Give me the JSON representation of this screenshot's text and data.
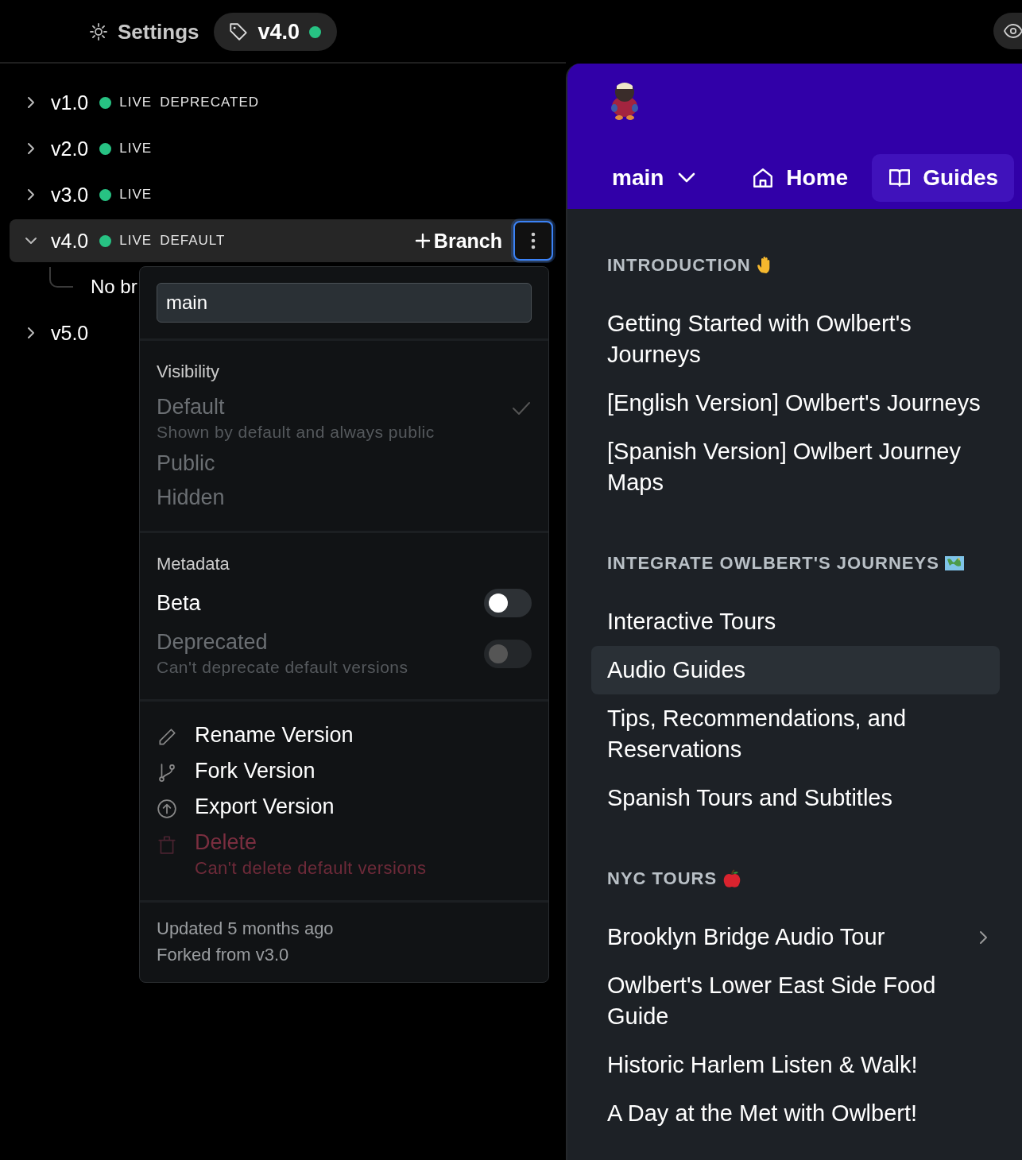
{
  "header": {
    "settings_label": "Settings",
    "version_badge": {
      "label": "v4.0",
      "live": true
    }
  },
  "versions": [
    {
      "label": "v1.0",
      "live": true,
      "expanded": false,
      "selected": false,
      "tags": [
        "LIVE",
        "DEPRECATED"
      ]
    },
    {
      "label": "v2.0",
      "live": true,
      "expanded": false,
      "selected": false,
      "tags": [
        "LIVE"
      ]
    },
    {
      "label": "v3.0",
      "live": true,
      "expanded": false,
      "selected": false,
      "tags": [
        "LIVE"
      ]
    },
    {
      "label": "v4.0",
      "live": true,
      "expanded": true,
      "selected": true,
      "tags": [
        "LIVE",
        "DEFAULT"
      ],
      "branch_button": "Branch",
      "children": [
        {
          "label": "No br"
        }
      ]
    },
    {
      "label": "v5.0",
      "live": false,
      "expanded": false,
      "selected": false
    }
  ],
  "version_menu": {
    "name_field": {
      "value": "main"
    },
    "visibility": {
      "title": "Visibility",
      "options": [
        {
          "label": "Default",
          "description": "Shown by default and always public",
          "selected": true,
          "disabled": true
        },
        {
          "label": "Public",
          "selected": false,
          "disabled": true
        },
        {
          "label": "Hidden",
          "selected": false,
          "disabled": true
        }
      ]
    },
    "metadata": {
      "title": "Metadata",
      "toggles": [
        {
          "label": "Beta",
          "on": false,
          "disabled": false
        },
        {
          "label": "Deprecated",
          "description": "Can't deprecate default versions",
          "on": false,
          "disabled": true
        }
      ]
    },
    "actions": [
      {
        "kind": "rename",
        "label": "Rename Version",
        "disabled": false
      },
      {
        "kind": "fork",
        "label": "Fork Version",
        "disabled": false
      },
      {
        "kind": "export",
        "label": "Export Version",
        "disabled": false
      },
      {
        "kind": "delete",
        "label": "Delete",
        "description": "Can't delete default versions",
        "disabled": true
      }
    ],
    "footer": [
      "Updated 5 months ago",
      "Forked from v3.0"
    ]
  },
  "preview": {
    "branch_selector": {
      "label": "main"
    },
    "nav_tabs": [
      {
        "kind": "home",
        "label": "Home",
        "selected": false
      },
      {
        "kind": "guides",
        "label": "Guides",
        "selected": true
      }
    ],
    "sections": [
      {
        "title": "INTRODUCTION",
        "items": [
          {
            "label": "Getting Started with Owlbert's Journeys",
            "selected": false,
            "expandable": false
          },
          {
            "label": "[English Version] Owlbert's Journeys",
            "selected": false,
            "expandable": false
          },
          {
            "label": "[Spanish Version] Owlbert Journey Maps",
            "selected": false,
            "expandable": false
          }
        ]
      },
      {
        "title": "INTEGRATE OWLBERT'S JOURNEYS",
        "items": [
          {
            "label": "Interactive Tours",
            "selected": false,
            "expandable": false
          },
          {
            "label": "Audio Guides",
            "selected": true,
            "expandable": false
          },
          {
            "label": "Tips, Recommendations, and Reservations",
            "selected": false,
            "expandable": false
          },
          {
            "label": "Spanish Tours and Subtitles",
            "selected": false,
            "expandable": false
          }
        ]
      },
      {
        "title": "NYC TOURS",
        "items": [
          {
            "label": "Brooklyn Bridge Audio Tour",
            "selected": false,
            "expandable": true
          },
          {
            "label": "Owlbert's Lower East Side Food Guide",
            "selected": false,
            "expandable": false
          },
          {
            "label": "Historic Harlem Listen & Walk!",
            "selected": false,
            "expandable": false
          },
          {
            "label": "A Day at the Met with Owlbert!",
            "selected": false,
            "expandable": false
          }
        ]
      }
    ]
  }
}
